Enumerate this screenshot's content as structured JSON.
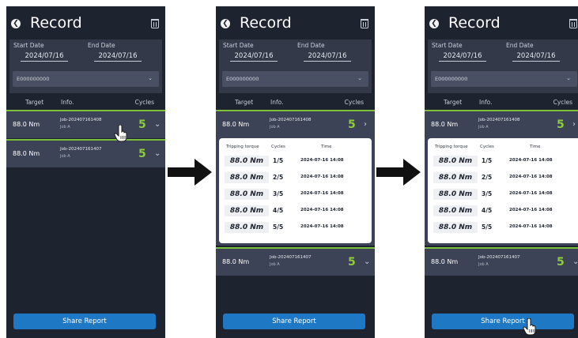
{
  "screens": [
    {
      "title": "Record",
      "filters": {
        "start_label": "Start Date",
        "start_value": "2024/07/16",
        "end_label": "End Date",
        "end_value": "2024/07/16",
        "device": "E000000000"
      },
      "columns": {
        "target": "Target",
        "info": "Info.",
        "cycles": "Cycles"
      },
      "records": [
        {
          "torque": "88.0 Nm",
          "job": "Job-202407161408",
          "sub": "Job A",
          "cycles": "5"
        },
        {
          "torque": "88.0 Nm",
          "job": "Job-202407161407",
          "sub": "Job A",
          "cycles": "5"
        }
      ],
      "share_label": "Share Report"
    },
    {
      "title": "Record",
      "filters": {
        "start_label": "Start Date",
        "start_value": "2024/07/16",
        "end_label": "End Date",
        "end_value": "2024/07/16",
        "device": "E000000000"
      },
      "columns": {
        "target": "Target",
        "info": "Info.",
        "cycles": "Cycles"
      },
      "records": [
        {
          "torque": "88.0 Nm",
          "job": "Job-202407161408",
          "sub": "Job A",
          "cycles": "5"
        },
        {
          "torque": "88.0 Nm",
          "job": "Job-202407161407",
          "sub": "Job A",
          "cycles": "5"
        }
      ],
      "detail": {
        "headers": {
          "torque": "Tripping torque",
          "cycles": "Cycles",
          "time": "Time"
        },
        "rows": [
          {
            "torque": "88.0 Nm",
            "cycle": "1/5",
            "time": "2024-07-16 14:08"
          },
          {
            "torque": "88.0 Nm",
            "cycle": "2/5",
            "time": "2024-07-16 14:08"
          },
          {
            "torque": "88.0 Nm",
            "cycle": "3/5",
            "time": "2024-07-16 14:08"
          },
          {
            "torque": "88.0 Nm",
            "cycle": "4/5",
            "time": "2024-07-16 14:08"
          },
          {
            "torque": "88.0 Nm",
            "cycle": "5/5",
            "time": "2024-07-16 14:08"
          }
        ]
      },
      "share_label": "Share Report"
    },
    {
      "title": "Record",
      "filters": {
        "start_label": "Start Date",
        "start_value": "2024/07/16",
        "end_label": "End Date",
        "end_value": "2024/07/16",
        "device": "E000000000"
      },
      "columns": {
        "target": "Target",
        "info": "Info.",
        "cycles": "Cycles"
      },
      "records": [
        {
          "torque": "88.0 Nm",
          "job": "Job-202407161408",
          "sub": "Job A",
          "cycles": "5"
        },
        {
          "torque": "88.0 Nm",
          "job": "Job-202407161407",
          "sub": "Job A",
          "cycles": "5"
        }
      ],
      "detail": {
        "headers": {
          "torque": "Tripping torque",
          "cycles": "Cycles",
          "time": "Time"
        },
        "rows": [
          {
            "torque": "88.0 Nm",
            "cycle": "1/5",
            "time": "2024-07-16 14:08"
          },
          {
            "torque": "88.0 Nm",
            "cycle": "2/5",
            "time": "2024-07-16 14:08"
          },
          {
            "torque": "88.0 Nm",
            "cycle": "3/5",
            "time": "2024-07-16 14:08"
          },
          {
            "torque": "88.0 Nm",
            "cycle": "4/5",
            "time": "2024-07-16 14:08"
          },
          {
            "torque": "88.0 Nm",
            "cycle": "5/5",
            "time": "2024-07-16 14:08"
          }
        ]
      },
      "share_label": "Share Report"
    }
  ],
  "colors": {
    "background": "#1e2330",
    "panel": "#34394a",
    "row": "#3c4356",
    "accent_green": "#8ecb3b",
    "button_blue": "#1f78c4"
  },
  "icons": [
    "back-icon",
    "trash-icon",
    "chevron-down-icon",
    "chevron-right-icon",
    "pointer-hand-icon",
    "flow-arrow-icon"
  ]
}
